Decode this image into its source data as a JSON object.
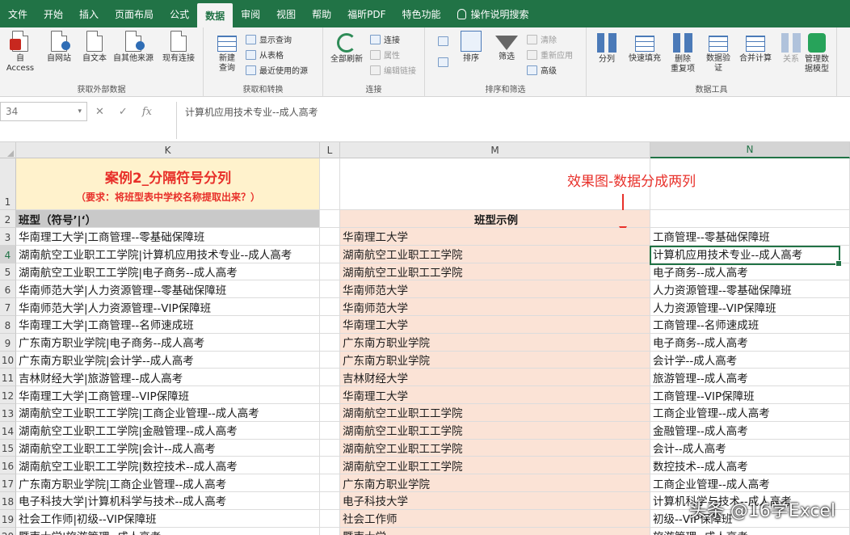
{
  "tabs": [
    "文件",
    "开始",
    "插入",
    "页面布局",
    "公式",
    "数据",
    "审阅",
    "视图",
    "帮助",
    "福昕PDF",
    "特色功能",
    "操作说明搜索"
  ],
  "active_tab": "数据",
  "ribbon": {
    "get_external": {
      "label": "获取外部数据",
      "buttons": [
        "自 Access",
        "自网站",
        "自文本",
        "自其他来源",
        "现有连接"
      ]
    },
    "get_transform": {
      "label": "获取和转换",
      "new_query": "新建\n查询",
      "items": [
        "显示查询",
        "从表格",
        "最近使用的源"
      ]
    },
    "connections": {
      "label": "连接",
      "refresh_all": "全部刷新",
      "items": [
        "连接",
        "属性",
        "编辑链接"
      ]
    },
    "sort_filter": {
      "label": "排序和筛选",
      "sort": "排序",
      "filter": "筛选",
      "items": [
        "清除",
        "重新应用",
        "高级"
      ]
    },
    "data_tools": {
      "label": "数据工具",
      "buttons": [
        "分列",
        "快速填充",
        "删除\n重复项",
        "数据验\n证",
        "合并计算",
        "关系",
        "管理数\n据模型"
      ]
    }
  },
  "formula_bar": {
    "name_box": "34",
    "cancel": "✕",
    "enter": "✓",
    "fx": "fx",
    "content": "计算机应用技术专业--成人高考"
  },
  "columns": [
    "K",
    "L",
    "M",
    "N"
  ],
  "selected_column": "N",
  "selected_row": "4",
  "sheet": {
    "title_main": "案例2_分隔符号分列",
    "title_sub": "（要求：将班型表中学校名称提取出来？）",
    "effect_label": "效果图-数据分成两列",
    "header_k": "班型（符号’|‘）",
    "header_m": "班型示例",
    "rows": [
      {
        "n": "3",
        "k": "华南理工大学|工商管理--零基础保障班",
        "m": "华南理工大学",
        "nn": "工商管理--零基础保障班"
      },
      {
        "n": "4",
        "k": "湖南航空工业职工工学院|计算机应用技术专业--成人高考",
        "m": "湖南航空工业职工工学院",
        "nn": "计算机应用技术专业--成人高考"
      },
      {
        "n": "5",
        "k": "湖南航空工业职工工学院|电子商务--成人高考",
        "m": "湖南航空工业职工工学院",
        "nn": "电子商务--成人高考"
      },
      {
        "n": "6",
        "k": "华南师范大学|人力资源管理--零基础保障班",
        "m": "华南师范大学",
        "nn": "人力资源管理--零基础保障班"
      },
      {
        "n": "7",
        "k": "华南师范大学|人力资源管理--VIP保障班",
        "m": "华南师范大学",
        "nn": "人力资源管理--VIP保障班"
      },
      {
        "n": "8",
        "k": "华南理工大学|工商管理--名师速成班",
        "m": "华南理工大学",
        "nn": "工商管理--名师速成班"
      },
      {
        "n": "9",
        "k": "广东南方职业学院|电子商务--成人高考",
        "m": "广东南方职业学院",
        "nn": "电子商务--成人高考"
      },
      {
        "n": "10",
        "k": "广东南方职业学院|会计学--成人高考",
        "m": "广东南方职业学院",
        "nn": "会计学--成人高考"
      },
      {
        "n": "11",
        "k": "吉林财经大学|旅游管理--成人高考",
        "m": "吉林财经大学",
        "nn": "旅游管理--成人高考"
      },
      {
        "n": "12",
        "k": "华南理工大学|工商管理--VIP保障班",
        "m": "华南理工大学",
        "nn": "工商管理--VIP保障班"
      },
      {
        "n": "13",
        "k": "湖南航空工业职工工学院|工商企业管理--成人高考",
        "m": "湖南航空工业职工工学院",
        "nn": "工商企业管理--成人高考"
      },
      {
        "n": "14",
        "k": "湖南航空工业职工工学院|金融管理--成人高考",
        "m": "湖南航空工业职工工学院",
        "nn": "金融管理--成人高考"
      },
      {
        "n": "15",
        "k": "湖南航空工业职工工学院|会计--成人高考",
        "m": "湖南航空工业职工工学院",
        "nn": "会计--成人高考"
      },
      {
        "n": "16",
        "k": "湖南航空工业职工工学院|数控技术--成人高考",
        "m": "湖南航空工业职工工学院",
        "nn": "数控技术--成人高考"
      },
      {
        "n": "17",
        "k": "广东南方职业学院|工商企业管理--成人高考",
        "m": "广东南方职业学院",
        "nn": "工商企业管理--成人高考"
      },
      {
        "n": "18",
        "k": "电子科技大学|计算机科学与技术--成人高考",
        "m": "电子科技大学",
        "nn": "计算机科学与技术--成人高考"
      },
      {
        "n": "19",
        "k": "社会工作师|初级--VIP保障班",
        "m": "社会工作师",
        "nn": "初级--VIP保障班"
      },
      {
        "n": "20",
        "k": "暨南大学|旅游管理--成人高考",
        "m": "暨南大学",
        "nn": "旅游管理--成人高考"
      }
    ]
  },
  "watermark": "头条 @16学Excel",
  "colors": {
    "excel_green": "#217346",
    "title_red": "#e8302a",
    "title_bg": "#fff2cc",
    "header_gray": "#c9c9c9",
    "example_peach": "#fbe3d6"
  }
}
